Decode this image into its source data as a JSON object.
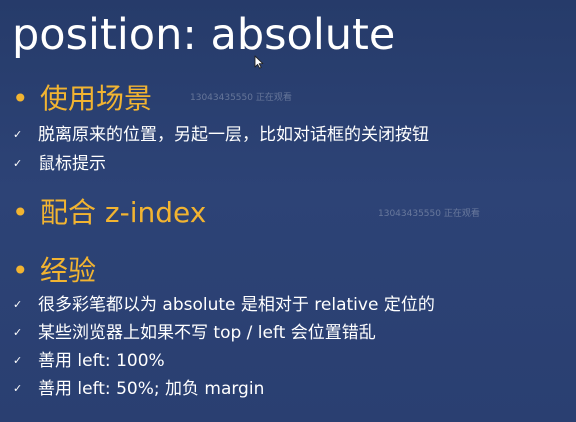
{
  "slide": {
    "title": "position: absolute",
    "sections": [
      {
        "heading": "使用场景",
        "items": [
          "脱离原来的位置，另起一层，比如对话框的关闭按钮",
          "鼠标提示"
        ]
      },
      {
        "heading": "配合 z-index",
        "items": []
      },
      {
        "heading": "经验",
        "items": [
          "很多彩笔都以为 absolute 是相对于 relative 定位的",
          "某些浏览器上如果不写 top / left 会位置错乱",
          "善用 left: 100%",
          "善用 left: 50%; 加负 margin"
        ]
      }
    ]
  },
  "bullets": {
    "section": "•",
    "item": "✓"
  },
  "watermarks": [
    "13043435550 正在观看",
    "13043435550 正在观看"
  ],
  "colors": {
    "background": "#2b4172",
    "heading": "#f2b431",
    "text": "#ffffff"
  },
  "icons": {
    "cursor": "arrow-cursor-icon"
  }
}
